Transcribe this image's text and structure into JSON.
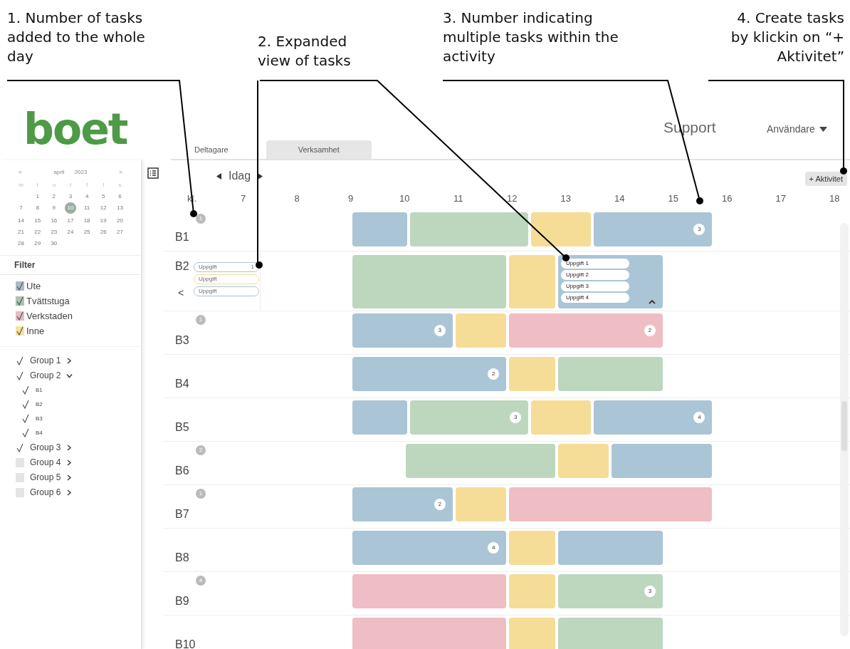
{
  "annotations": [
    {
      "text": "1. Number of tasks added to the whole day"
    },
    {
      "text": "2. Expanded view of tasks"
    },
    {
      "text": "3. Number indicating multiple tasks within the activity"
    },
    {
      "text": "4. Create tasks by klickin on  “+ Aktivitet”"
    }
  ],
  "header": {
    "logo": "boet",
    "support": "Support",
    "user": "Användare"
  },
  "tabs": [
    {
      "label": "Deltagare",
      "selected": true
    },
    {
      "label": "Verksamhet",
      "selected": false
    }
  ],
  "calendar": {
    "month": "april",
    "year": "2023",
    "prev": "<",
    "next": ">",
    "weekdays": [
      "m",
      "t",
      "o",
      "t",
      "f",
      "l",
      "s"
    ],
    "days": [
      {
        "label": "1",
        "selected": false
      },
      {
        "label": "2",
        "selected": false
      },
      {
        "label": "3",
        "selected": false
      },
      {
        "label": "4",
        "selected": false
      },
      {
        "label": "5",
        "selected": false
      },
      {
        "label": "6",
        "selected": false
      },
      {
        "label": "7",
        "selected": false
      },
      {
        "label": "8",
        "selected": false
      },
      {
        "label": "9",
        "selected": false
      },
      {
        "label": "10",
        "selected": true
      },
      {
        "label": "11",
        "selected": false
      },
      {
        "label": "12",
        "selected": false
      },
      {
        "label": "13",
        "selected": false
      },
      {
        "label": "14",
        "selected": false
      },
      {
        "label": "15",
        "selected": false
      },
      {
        "label": "16",
        "selected": false
      },
      {
        "label": "17",
        "selected": false
      },
      {
        "label": "18",
        "selected": false
      },
      {
        "label": "19",
        "selected": false
      },
      {
        "label": "20",
        "selected": false
      },
      {
        "label": "21",
        "selected": false
      },
      {
        "label": "22",
        "selected": false
      },
      {
        "label": "23",
        "selected": false
      },
      {
        "label": "24",
        "selected": false
      },
      {
        "label": "25",
        "selected": false
      },
      {
        "label": "26",
        "selected": false
      },
      {
        "label": "27",
        "selected": false
      },
      {
        "label": "28",
        "selected": false
      },
      {
        "label": "29",
        "selected": false
      },
      {
        "label": "30",
        "selected": false
      }
    ]
  },
  "filter": {
    "title": "Filter",
    "categories": [
      {
        "label": "Ute",
        "checked": true,
        "color": "#a9bcc6"
      },
      {
        "label": "Tvättstuga",
        "checked": true,
        "color": "#aec4b2"
      },
      {
        "label": "Verkstaden",
        "checked": true,
        "color": "#e7bcc3"
      },
      {
        "label": "Inne",
        "checked": true,
        "color": "#f5e2a0"
      }
    ],
    "groups": [
      {
        "label": "Group 1",
        "checked": true,
        "expanded": false
      },
      {
        "label": "Group 2",
        "checked": true,
        "expanded": true,
        "children": [
          {
            "label": "B1",
            "checked": true
          },
          {
            "label": "B2",
            "checked": true
          },
          {
            "label": "B3",
            "checked": true
          },
          {
            "label": "B4",
            "checked": true
          }
        ]
      },
      {
        "label": "Group 3",
        "checked": true,
        "expanded": false
      },
      {
        "label": "Group 4",
        "checked": false,
        "expanded": false
      },
      {
        "label": "Group 5",
        "checked": false,
        "expanded": false
      },
      {
        "label": "Group 6",
        "checked": false,
        "expanded": false
      }
    ]
  },
  "nav": {
    "today": "Idag",
    "add_button": "+ Aktivitet"
  },
  "timeline": {
    "hour_label": "kl.",
    "hours": [
      "7",
      "8",
      "9",
      "10",
      "11",
      "12",
      "13",
      "14",
      "15",
      "16",
      "17",
      "18"
    ]
  },
  "rows": [
    {
      "label": "B1",
      "day_count": "1",
      "bars": [
        {
          "color": "#aac5d6",
          "expanded": false
        },
        {
          "color": "#bdd7bf",
          "expanded": false
        },
        {
          "color": "#f5dd98",
          "expanded": false
        },
        {
          "color": "#aac5d6",
          "count": "3",
          "expanded": false
        }
      ]
    },
    {
      "label": "B2",
      "collapse": "<",
      "side_tasks": [
        {
          "label": "Uppgift",
          "color": "#aac5d6",
          "count": "1"
        },
        {
          "label": "Uppgift",
          "color": "#f5dd98"
        },
        {
          "label": "Uppgift",
          "color": "#aac5d6"
        }
      ],
      "bars": [
        {
          "color": "#bdd7bf",
          "expanded": false
        },
        {
          "color": "#f5dd98",
          "expanded": false
        },
        {
          "color": "#aac5d6",
          "expanded": true,
          "tasks": [
            "Uppgift 1",
            "Uppgift 2",
            "Uppgift 3",
            "Uppgift 4"
          ]
        }
      ]
    },
    {
      "label": "B3",
      "day_count": "1",
      "bars": [
        {
          "color": "#aac5d6",
          "count": "3",
          "expanded": false
        },
        {
          "color": "#f5dd98",
          "expanded": false
        },
        {
          "color": "#efbdc4",
          "count": "2",
          "expanded": false
        }
      ]
    },
    {
      "label": "B4",
      "bars": [
        {
          "color": "#aac5d6",
          "count": "2",
          "expanded": false
        },
        {
          "color": "#f5dd98",
          "expanded": false
        },
        {
          "color": "#bdd7bf",
          "expanded": false
        }
      ]
    },
    {
      "label": "B5",
      "bars": [
        {
          "color": "#aac5d6",
          "expanded": false
        },
        {
          "color": "#bdd7bf",
          "count": "3",
          "expanded": false
        },
        {
          "color": "#f5dd98",
          "expanded": false
        },
        {
          "color": "#aac5d6",
          "count": "4",
          "expanded": false
        }
      ]
    },
    {
      "label": "B6",
      "day_count": "2",
      "bars": [
        {
          "color": "#bdd7bf",
          "expanded": false
        },
        {
          "color": "#f5dd98",
          "expanded": false
        },
        {
          "color": "#aac5d6",
          "expanded": false
        }
      ]
    },
    {
      "label": "B7",
      "day_count": "1",
      "bars": [
        {
          "color": "#aac5d6",
          "count": "2",
          "expanded": false
        },
        {
          "color": "#f5dd98",
          "expanded": false
        },
        {
          "color": "#efbdc4",
          "expanded": false
        }
      ]
    },
    {
      "label": "B8",
      "bars": [
        {
          "color": "#aac5d6",
          "count": "4",
          "expanded": false
        },
        {
          "color": "#f5dd98",
          "expanded": false
        },
        {
          "color": "#aac5d6",
          "expanded": false
        }
      ]
    },
    {
      "label": "B9",
      "day_count": "4",
      "bars": [
        {
          "color": "#efbdc4",
          "expanded": false
        },
        {
          "color": "#f5dd98",
          "expanded": false
        },
        {
          "color": "#bdd7bf",
          "count": "3",
          "expanded": false
        }
      ]
    },
    {
      "label": "B10",
      "bars": [
        {
          "color": "#efbdc4",
          "expanded": false
        },
        {
          "color": "#f5dd98",
          "expanded": false
        },
        {
          "color": "#bdd7bf",
          "expanded": false
        }
      ]
    }
  ]
}
